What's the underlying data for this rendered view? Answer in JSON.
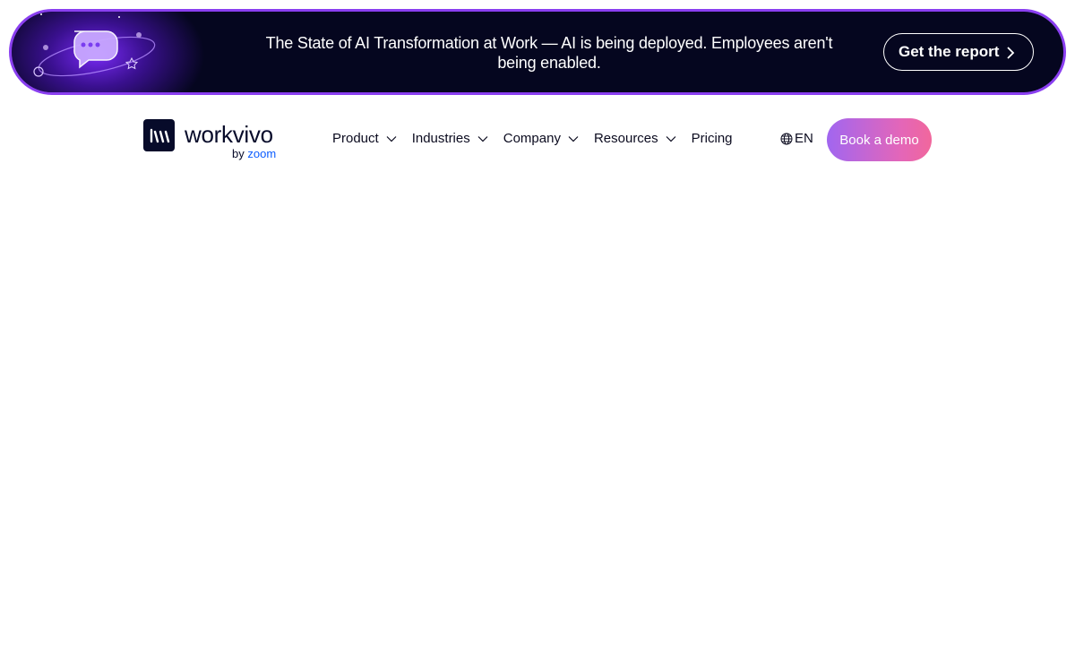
{
  "banner": {
    "message": "The State of AI Transformation at Work — AI is being deployed. Employees aren't being enabled.",
    "cta_label": "Get the report",
    "border_color": "#8a3ff0",
    "background_color": "#05061f"
  },
  "brand": {
    "name": "workvivo",
    "by": "by",
    "parent": "zoom",
    "parent_color": "#0b5cff"
  },
  "nav": {
    "items": [
      {
        "label": "Product",
        "has_dropdown": true
      },
      {
        "label": "Industries",
        "has_dropdown": true
      },
      {
        "label": "Company",
        "has_dropdown": true
      },
      {
        "label": "Resources",
        "has_dropdown": true
      },
      {
        "label": "Pricing",
        "has_dropdown": false
      }
    ],
    "language": "EN",
    "language_icon": "globe-icon",
    "cta_label": "Book a demo",
    "cta_gradient": [
      "#a166f0",
      "#f1679c"
    ]
  }
}
